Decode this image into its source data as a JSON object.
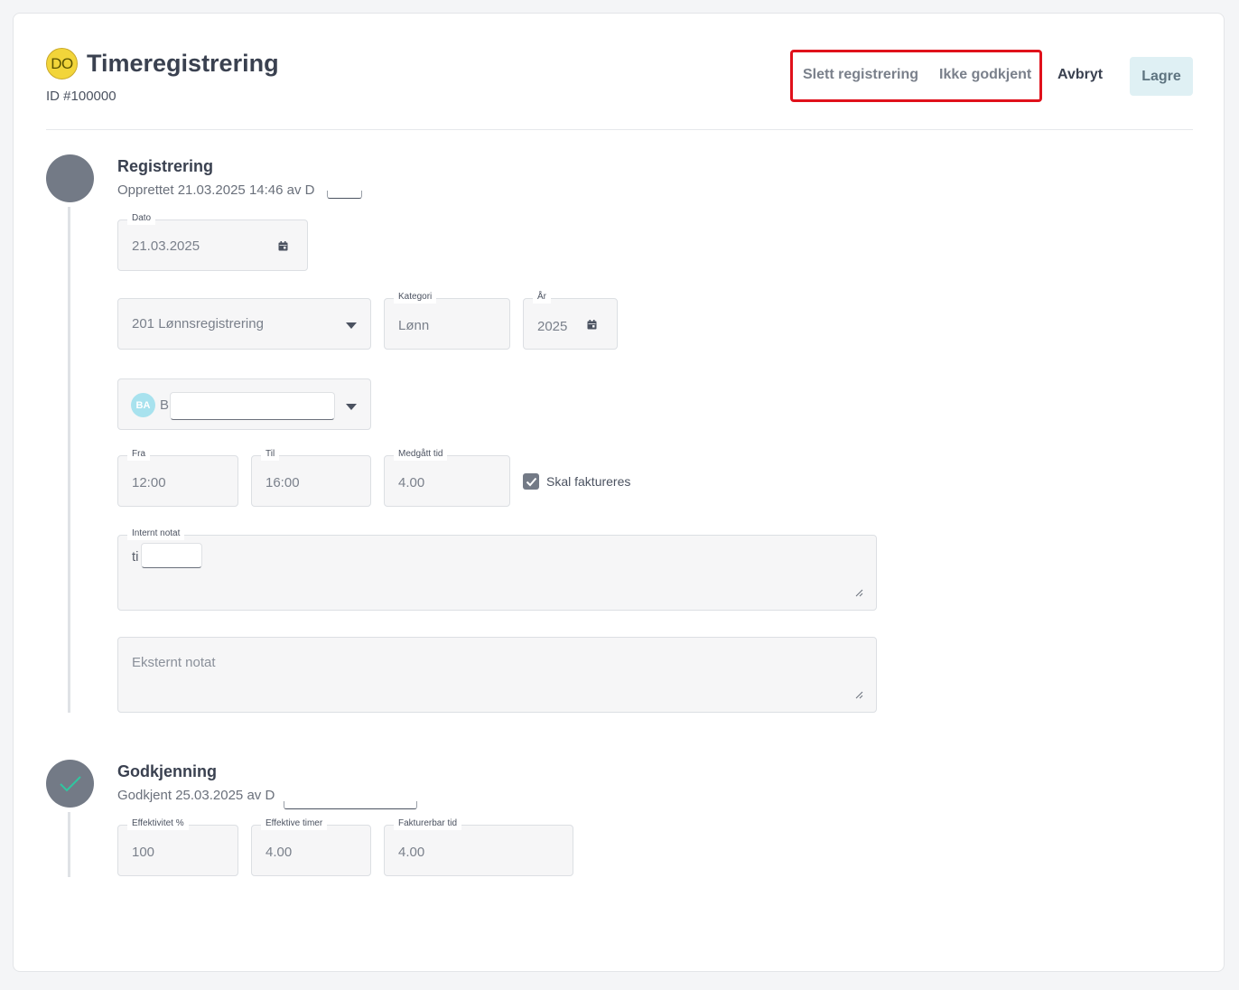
{
  "header": {
    "avatar_initials": "DO",
    "title": "Timeregistrering",
    "record_id": "ID #100000",
    "actions": {
      "delete_label": "Slett registrering",
      "reject_label": "Ikke godkjent",
      "cancel_label": "Avbryt",
      "save_label": "Lagre"
    }
  },
  "registration": {
    "title": "Registrering",
    "subtitle": "Opprettet 21.03.2025 14:46 av D",
    "date": {
      "label": "Dato",
      "value": "21.03.2025"
    },
    "project": {
      "value": "201 Lønnsregistrering"
    },
    "category": {
      "label": "Kategori",
      "value": "Lønn"
    },
    "year": {
      "label": "År",
      "value": "2025"
    },
    "person": {
      "initials": "BA",
      "value": "B"
    },
    "from": {
      "label": "Fra",
      "value": "12:00"
    },
    "to": {
      "label": "Til",
      "value": "16:00"
    },
    "duration": {
      "label": "Medgått tid",
      "value": "4.00"
    },
    "billable": {
      "label": "Skal faktureres",
      "checked": true
    },
    "internal_note": {
      "label": "Internt notat",
      "value": "ti"
    },
    "external_note": {
      "placeholder": "Eksternt notat"
    }
  },
  "approval": {
    "title": "Godkjenning",
    "subtitle": "Godkjent 25.03.2025 av D",
    "efficiency": {
      "label": "Effektivitet %",
      "value": "100"
    },
    "effective_hours": {
      "label": "Effektive timer",
      "value": "4.00"
    },
    "billable_time": {
      "label": "Fakturerbar tid",
      "value": "4.00"
    }
  },
  "colors": {
    "accent_highlight": "#e0111b",
    "save_bg": "#dff0f4",
    "step_circle": "#737a86",
    "check_mark": "#2fc6a0",
    "avatar_yellow": "#f2d53a",
    "avatar_cyan": "#a8e2ee"
  },
  "icons": [
    "calendar-icon",
    "chevron-down-icon",
    "check-icon",
    "resize-handle-icon"
  ]
}
